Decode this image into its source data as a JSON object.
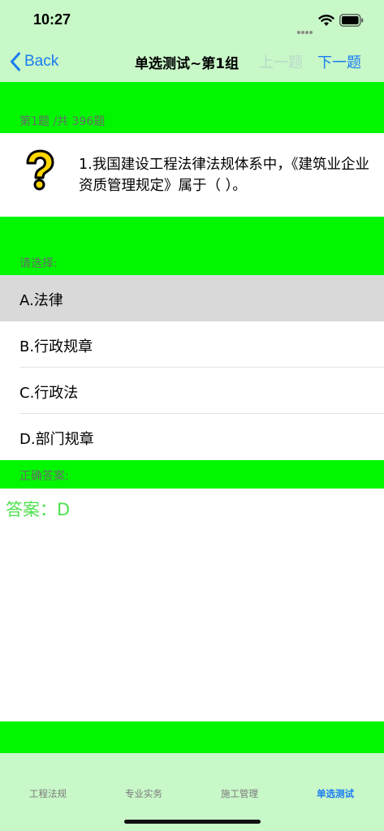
{
  "status_bar": {
    "time": "10:27"
  },
  "nav": {
    "back_label": "Back",
    "title": "单选测试~第1组",
    "prev_label": "上一题",
    "next_label": "下一题"
  },
  "question": {
    "counter": "第1题 /共 396题",
    "text": "1.我国建设工程法律法规体系中，《建筑业企业资质管理规定》属于（    ）。",
    "icon": "question-mark-icon"
  },
  "choices": {
    "prompt": "请选择:",
    "options": [
      {
        "label": "A.法律",
        "selected": true
      },
      {
        "label": "B.行政规章",
        "selected": false
      },
      {
        "label": "C.行政法",
        "selected": false
      },
      {
        "label": "D.部门规章",
        "selected": false
      }
    ]
  },
  "answer": {
    "header": "正确答案:",
    "text": "答案：D"
  },
  "tabs": [
    {
      "label": "工程法规",
      "active": false
    },
    {
      "label": "专业实务",
      "active": false
    },
    {
      "label": "施工管理",
      "active": false
    },
    {
      "label": "单选测试",
      "active": true
    }
  ],
  "colors": {
    "accent": "#1a7cf2",
    "bar_background": "#c8f7c8",
    "band_green": "#00f700",
    "answer_green": "#4fe04f",
    "selected_row": "#d9d9d9"
  }
}
